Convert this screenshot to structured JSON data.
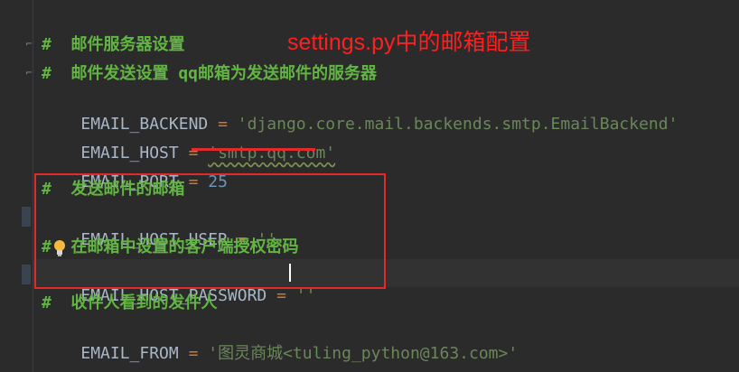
{
  "editor": {
    "lines": [
      {
        "kind": "comment",
        "text": "#  邮件服务器设置"
      },
      {
        "kind": "comment",
        "text": "#  邮件发送设置 qq邮箱为发送邮件的服务器"
      },
      {
        "kind": "assign",
        "key": "EMAIL_BACKEND",
        "op": " = ",
        "value": "'django.core.mail.backends.smtp.EmailBackend'"
      },
      {
        "kind": "assign",
        "key": "EMAIL_HOST",
        "op": " = ",
        "value": "'smtp.qq.com'"
      },
      {
        "kind": "assign",
        "key": "EMAIL_PORT",
        "op": " = ",
        "value": "25"
      },
      {
        "kind": "comment",
        "text": "#  发送邮件的邮箱"
      },
      {
        "kind": "assign",
        "key": "EMAIL_HOST_USER",
        "op": " = ",
        "value": "''"
      },
      {
        "kind": "comment",
        "text": "#  在邮箱中设置的客户端授权密码"
      },
      {
        "kind": "assign",
        "key": "EMAIL_HOST_PASSWORD",
        "op": " = ",
        "value": "''"
      },
      {
        "kind": "comment",
        "text": "#  收件人看到的发件人"
      },
      {
        "kind": "assign",
        "key": "EMAIL_FROM",
        "op": " = ",
        "value": "'图灵商城<tuling_python@163.com>'"
      }
    ]
  },
  "annotation": {
    "text": "settings.py中的邮箱配置",
    "color": "#ff1f1f"
  }
}
